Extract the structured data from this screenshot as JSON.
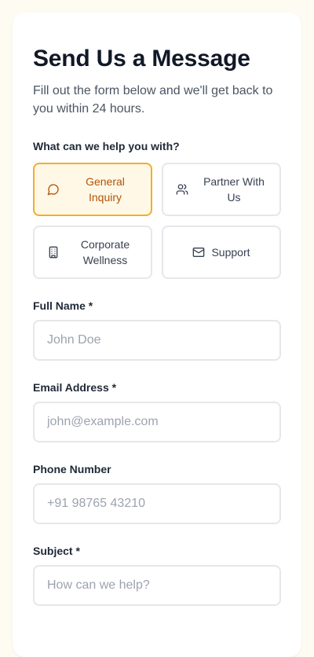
{
  "form": {
    "title": "Send Us a Message",
    "subtitle": "Fill out the form below and we'll get back to you within 24 hours.",
    "help_label": "What can we help you with?",
    "options": [
      {
        "label": "General Inquiry",
        "icon": "message-circle-icon",
        "selected": true
      },
      {
        "label": "Partner With Us",
        "icon": "users-icon",
        "selected": false
      },
      {
        "label": "Corporate Wellness",
        "icon": "building-icon",
        "selected": false
      },
      {
        "label": "Support",
        "icon": "mail-icon",
        "selected": false
      }
    ],
    "fields": {
      "full_name": {
        "label": "Full Name *",
        "placeholder": "John Doe"
      },
      "email": {
        "label": "Email Address *",
        "placeholder": "john@example.com"
      },
      "phone": {
        "label": "Phone Number",
        "placeholder": "+91 98765 43210"
      },
      "subject": {
        "label": "Subject *",
        "placeholder": "How can we help?"
      }
    }
  },
  "colors": {
    "accent": "#f3ac2c",
    "accent_text": "#b45309",
    "selected_bg": "#fff8e6",
    "page_bg": "#fefcf2"
  }
}
